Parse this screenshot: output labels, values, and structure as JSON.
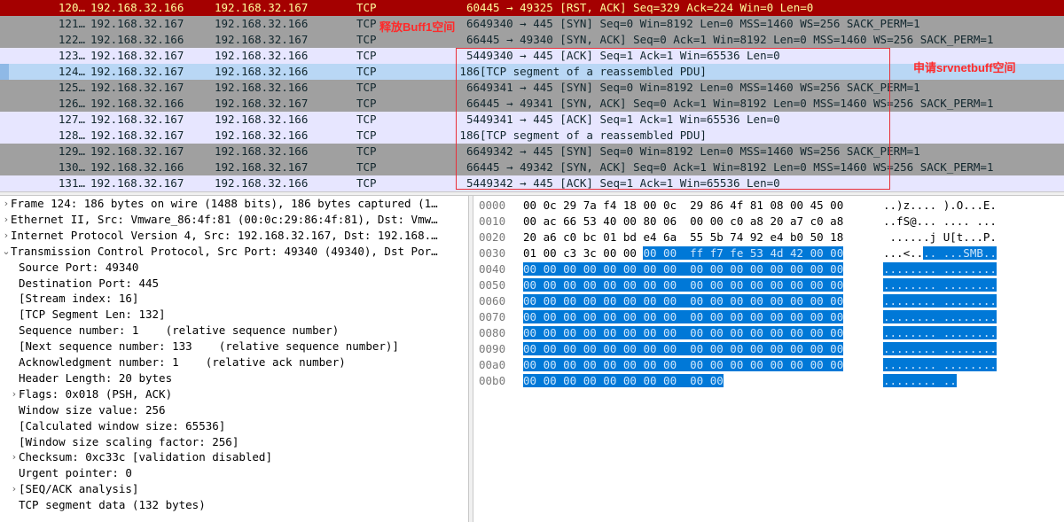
{
  "packets": [
    {
      "no": "120…",
      "src": "192.168.32.166",
      "dst": "192.168.32.167",
      "proto": "TCP",
      "len": "60",
      "info": "445 → 49325 [RST, ACK] Seq=329 Ack=224 Win=0 Len=0",
      "bg": "#a40000",
      "fg": "#fffc9c"
    },
    {
      "no": "121…",
      "src": "192.168.32.167",
      "dst": "192.168.32.166",
      "proto": "TCP",
      "len": "66",
      "info": "49340 → 445 [SYN] Seq=0 Win=8192 Len=0 MSS=1460 WS=256 SACK_PERM=1",
      "bg": "#a0a0a0",
      "fg": "#12272e"
    },
    {
      "no": "122…",
      "src": "192.168.32.166",
      "dst": "192.168.32.167",
      "proto": "TCP",
      "len": "66",
      "info": "445 → 49340 [SYN, ACK] Seq=0 Ack=1 Win=8192 Len=0 MSS=1460 WS=256 SACK_PERM=1",
      "bg": "#a0a0a0",
      "fg": "#12272e"
    },
    {
      "no": "123…",
      "src": "192.168.32.167",
      "dst": "192.168.32.166",
      "proto": "TCP",
      "len": "54",
      "info": "49340 → 445 [ACK] Seq=1 Ack=1 Win=65536 Len=0",
      "bg": "#e7e6ff",
      "fg": "#12272e"
    },
    {
      "no": "124…",
      "src": "192.168.32.167",
      "dst": "192.168.32.166",
      "proto": "TCP",
      "len": "186",
      "info": "[TCP segment of a reassembled PDU]",
      "bg": "#b9d7f5",
      "fg": "#12272e",
      "selected": true
    },
    {
      "no": "125…",
      "src": "192.168.32.167",
      "dst": "192.168.32.166",
      "proto": "TCP",
      "len": "66",
      "info": "49341 → 445 [SYN] Seq=0 Win=8192 Len=0 MSS=1460 WS=256 SACK_PERM=1",
      "bg": "#a0a0a0",
      "fg": "#12272e"
    },
    {
      "no": "126…",
      "src": "192.168.32.166",
      "dst": "192.168.32.167",
      "proto": "TCP",
      "len": "66",
      "info": "445 → 49341 [SYN, ACK] Seq=0 Ack=1 Win=8192 Len=0 MSS=1460 WS=256 SACK_PERM=1",
      "bg": "#a0a0a0",
      "fg": "#12272e"
    },
    {
      "no": "127…",
      "src": "192.168.32.167",
      "dst": "192.168.32.166",
      "proto": "TCP",
      "len": "54",
      "info": "49341 → 445 [ACK] Seq=1 Ack=1 Win=65536 Len=0",
      "bg": "#e7e6ff",
      "fg": "#12272e"
    },
    {
      "no": "128…",
      "src": "192.168.32.167",
      "dst": "192.168.32.166",
      "proto": "TCP",
      "len": "186",
      "info": "[TCP segment of a reassembled PDU]",
      "bg": "#e7e6ff",
      "fg": "#12272e"
    },
    {
      "no": "129…",
      "src": "192.168.32.167",
      "dst": "192.168.32.166",
      "proto": "TCP",
      "len": "66",
      "info": "49342 → 445 [SYN] Seq=0 Win=8192 Len=0 MSS=1460 WS=256 SACK_PERM=1",
      "bg": "#a0a0a0",
      "fg": "#12272e"
    },
    {
      "no": "130…",
      "src": "192.168.32.166",
      "dst": "192.168.32.167",
      "proto": "TCP",
      "len": "66",
      "info": "445 → 49342 [SYN, ACK] Seq=0 Ack=1 Win=8192 Len=0 MSS=1460 WS=256 SACK_PERM=1",
      "bg": "#a0a0a0",
      "fg": "#12272e"
    },
    {
      "no": "131…",
      "src": "192.168.32.167",
      "dst": "192.168.32.166",
      "proto": "TCP",
      "len": "54",
      "info": "49342 → 445 [ACK] Seq=1 Ack=1 Win=65536 Len=0",
      "bg": "#e7e6ff",
      "fg": "#12272e"
    }
  ],
  "annotations": {
    "release_buff": "释放Buff1空间",
    "alloc_srvnetbuff": "申请srvnetbuff空间",
    "color": "#ff2a2a"
  },
  "details": [
    {
      "text": "Frame 124: 186 bytes on wire (1488 bits), 186 bytes captured (1…",
      "expander": "›",
      "level": 0
    },
    {
      "text": "Ethernet II, Src: Vmware_86:4f:81 (00:0c:29:86:4f:81), Dst: Vmw…",
      "expander": "›",
      "level": 0
    },
    {
      "text": "Internet Protocol Version 4, Src: 192.168.32.167, Dst: 192.168.…",
      "expander": "›",
      "level": 0
    },
    {
      "text": "Transmission Control Protocol, Src Port: 49340 (49340), Dst Por…",
      "expander": "⌄",
      "level": 0
    },
    {
      "text": "Source Port: 49340",
      "level": 1
    },
    {
      "text": "Destination Port: 445",
      "level": 1
    },
    {
      "text": "[Stream index: 16]",
      "level": 1
    },
    {
      "text": "[TCP Segment Len: 132]",
      "level": 1
    },
    {
      "text": "Sequence number: 1    (relative sequence number)",
      "level": 1
    },
    {
      "text": "[Next sequence number: 133    (relative sequence number)]",
      "level": 1
    },
    {
      "text": "Acknowledgment number: 1    (relative ack number)",
      "level": 1
    },
    {
      "text": "Header Length: 20 bytes",
      "level": 1
    },
    {
      "text": "Flags: 0x018 (PSH, ACK)",
      "expander": "›",
      "level": 1
    },
    {
      "text": "Window size value: 256",
      "level": 1
    },
    {
      "text": "[Calculated window size: 65536]",
      "level": 1
    },
    {
      "text": "[Window size scaling factor: 256]",
      "level": 1
    },
    {
      "text": "Checksum: 0xc33c [validation disabled]",
      "expander": "›",
      "level": 1
    },
    {
      "text": "Urgent pointer: 0",
      "level": 1
    },
    {
      "text": "[SEQ/ACK analysis]",
      "expander": "›",
      "level": 1
    },
    {
      "text": "TCP segment data (132 bytes)",
      "level": 1
    }
  ],
  "hex_rows": [
    {
      "off": "0000",
      "hex_plain": "00 0c 29 7a f4 18 00 0c  29 86 4f 81 08 00 45 00",
      "hex_hl": "",
      "asc_plain": "..)z.... ).O...E.",
      "asc_hl": ""
    },
    {
      "off": "0010",
      "hex_plain": "00 ac 66 53 40 00 80 06  00 00 c0 a8 20 a7 c0 a8",
      "hex_hl": "",
      "asc_plain": "..fS@... .... ...",
      "asc_hl": ""
    },
    {
      "off": "0020",
      "hex_plain": "20 a6 c0 bc 01 bd e4 6a  55 5b 74 92 e4 b0 50 18",
      "hex_hl": "",
      "asc_plain": " ......j U[t...P.",
      "asc_hl": ""
    },
    {
      "off": "0030",
      "hex_plain": "01 00 c3 3c 00 00 ",
      "hex_hl": "00 00  ff f7 fe 53 4d 42 00 00",
      "asc_plain": "...<..",
      "asc_hl": ".. ...SMB.."
    },
    {
      "off": "0040",
      "hex_plain": "",
      "hex_hl": "00 00 00 00 00 00 00 00  00 00 00 00 00 00 00 00",
      "asc_plain": "",
      "asc_hl": "........ ........"
    },
    {
      "off": "0050",
      "hex_plain": "",
      "hex_hl": "00 00 00 00 00 00 00 00  00 00 00 00 00 00 00 00",
      "asc_plain": "",
      "asc_hl": "........ ........"
    },
    {
      "off": "0060",
      "hex_plain": "",
      "hex_hl": "00 00 00 00 00 00 00 00  00 00 00 00 00 00 00 00",
      "asc_plain": "",
      "asc_hl": "........ ........"
    },
    {
      "off": "0070",
      "hex_plain": "",
      "hex_hl": "00 00 00 00 00 00 00 00  00 00 00 00 00 00 00 00",
      "asc_plain": "",
      "asc_hl": "........ ........"
    },
    {
      "off": "0080",
      "hex_plain": "",
      "hex_hl": "00 00 00 00 00 00 00 00  00 00 00 00 00 00 00 00",
      "asc_plain": "",
      "asc_hl": "........ ........"
    },
    {
      "off": "0090",
      "hex_plain": "",
      "hex_hl": "00 00 00 00 00 00 00 00  00 00 00 00 00 00 00 00",
      "asc_plain": "",
      "asc_hl": "........ ........"
    },
    {
      "off": "00a0",
      "hex_plain": "",
      "hex_hl": "00 00 00 00 00 00 00 00  00 00 00 00 00 00 00 00",
      "asc_plain": "",
      "asc_hl": "........ ........"
    },
    {
      "off": "00b0",
      "hex_plain": "",
      "hex_hl": "00 00 00 00 00 00 00 00  00 00",
      "asc_plain": "",
      "asc_hl": "........ .."
    }
  ]
}
